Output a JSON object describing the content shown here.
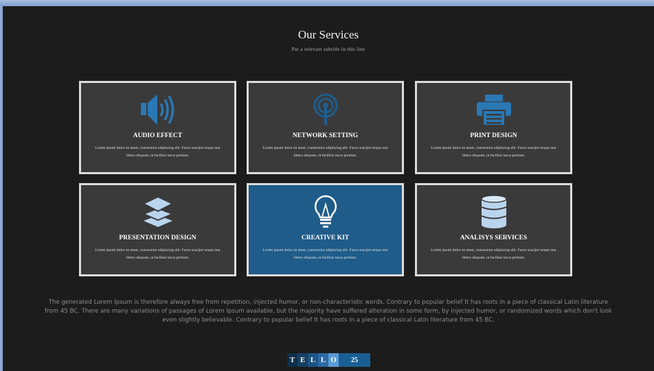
{
  "header": {
    "title": "Our Services",
    "subtitle": "Put a relevant subtitle in this line"
  },
  "cards": [
    {
      "heading": "AUDIO EFFECT",
      "desc": "Lorem ipsum dolor sit amet, consectetur adipiscing elit. Fusce suscipit neque non libero aliquam, ut facilisis lacus pretium.",
      "icon": "speaker-icon"
    },
    {
      "heading": "NETWORK SETTING",
      "desc": "Lorem ipsum dolor sit amet, consectetur adipiscing elit. Fusce suscipit neque non libero aliquam, ut facilisis lacus pretium.",
      "icon": "broadcast-icon"
    },
    {
      "heading": "PRINT DESIGN",
      "desc": "Lorem ipsum dolor sit amet, consectetur adipiscing elit. Fusce suscipit neque non libero aliquam, ut facilisis lacus pretium.",
      "icon": "printer-icon"
    },
    {
      "heading": "PRESENTATION DESIGN",
      "desc": "Lorem ipsum dolor sit amet, consectetur adipiscing elit. Fusce suscipit neque non libero aliquam, ut facilisis lacus pretium.",
      "icon": "layers-icon"
    },
    {
      "heading": "CREATIVE KIT",
      "desc": "Lorem ipsum dolor sit amet, consectetur adipiscing elit. Fusce suscipit neque non libero aliquam, ut facilisis lacus pretium.",
      "icon": "lightbulb-icon"
    },
    {
      "heading": "ANALISYS SERVICES",
      "desc": "Lorem ipsum dolor sit amet, consectetur adipiscing elit. Fusce suscipit neque non libero aliquam, ut facilisis lacus pretium.",
      "icon": "database-icon"
    }
  ],
  "body_text": "The generated Lorem Ipsum is therefore always free from repetition, injected humor, or non-characteristic words. Contrary to popular belief It has roots in a piece of classical Latin literature from 45 BC. There are many variations of passages of Lorem Ipsum available, but the majority have suffered alteration in some form, by injected humor, or randomized words which don't look even slightly believable. Contrary to popular belief It has roots in a piece of classical Latin literature from 45 BC.",
  "footer": {
    "letters": [
      "T",
      "E",
      "L",
      "L",
      "O"
    ],
    "page_number": "25"
  },
  "colors": {
    "background": "#1c1c1c",
    "card": "#3b3a3a",
    "card_highlight": "#1f5c8a",
    "card_border": "#dcdcdc",
    "icon_blue": "#2a78b4",
    "icon_light": "#b9d5ee"
  }
}
